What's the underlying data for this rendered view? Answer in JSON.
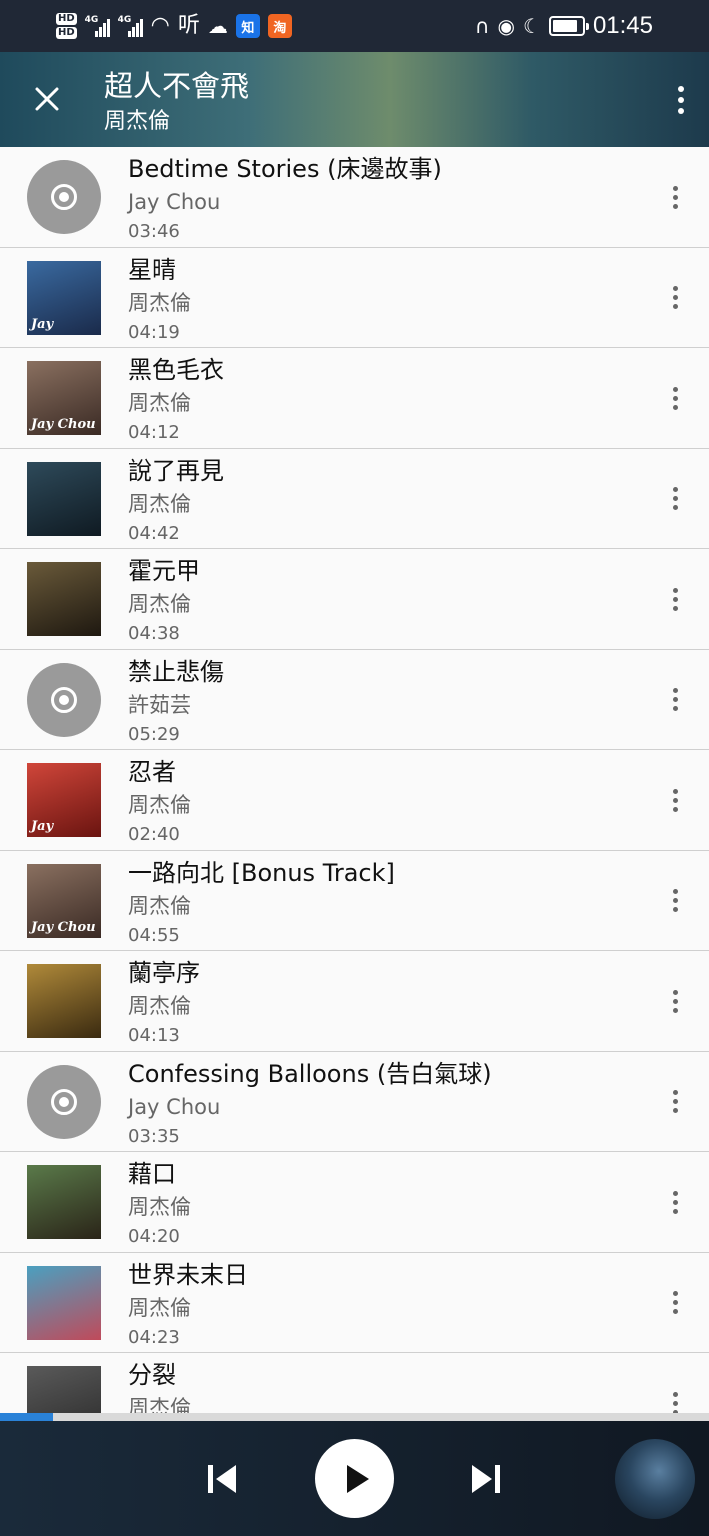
{
  "status_bar": {
    "hd_labels": [
      "HD",
      "HD"
    ],
    "network_1": "4G",
    "network_2": "4G",
    "app_text": "听",
    "badge_zhi": "知",
    "badge_tao": "淘",
    "battery_level": 0.85,
    "time": "01:45"
  },
  "header": {
    "title": "超人不會飛",
    "subtitle": "周杰倫"
  },
  "songs": [
    {
      "title": "Bedtime Stories (床邊故事)",
      "artist": "Jay Chou",
      "duration": "03:46",
      "art": "disc"
    },
    {
      "title": "星晴",
      "artist": "周杰倫",
      "duration": "04:19",
      "art": "cover",
      "art_text": "Jay",
      "colors": [
        "#3a6aa0",
        "#1a2a4a"
      ]
    },
    {
      "title": "黑色毛衣",
      "artist": "周杰倫",
      "duration": "04:12",
      "art": "cover",
      "art_text": "Jay Chou",
      "colors": [
        "#8a7060",
        "#3a2a24"
      ]
    },
    {
      "title": "說了再見",
      "artist": "周杰倫",
      "duration": "04:42",
      "art": "cover",
      "art_text": "",
      "colors": [
        "#2e4a5a",
        "#0f1a22"
      ]
    },
    {
      "title": "霍元甲",
      "artist": "周杰倫",
      "duration": "04:38",
      "art": "cover",
      "art_text": "",
      "colors": [
        "#6a5a3a",
        "#1e1810"
      ]
    },
    {
      "title": "禁止悲傷",
      "artist": "許茹芸",
      "duration": "05:29",
      "art": "disc"
    },
    {
      "title": "忍者",
      "artist": "周杰倫",
      "duration": "02:40",
      "art": "cover",
      "art_text": "Jay",
      "colors": [
        "#d0463a",
        "#6a1410"
      ]
    },
    {
      "title": "一路向北 [Bonus Track]",
      "artist": "周杰倫",
      "duration": "04:55",
      "art": "cover",
      "art_text": "Jay Chou",
      "colors": [
        "#8a7060",
        "#3a2a24"
      ]
    },
    {
      "title": "蘭亭序",
      "artist": "周杰倫",
      "duration": "04:13",
      "art": "cover",
      "art_text": "",
      "colors": [
        "#b08a3a",
        "#3a2a10"
      ]
    },
    {
      "title": "Confessing Balloons (告白氣球)",
      "artist": "Jay Chou",
      "duration": "03:35",
      "art": "disc"
    },
    {
      "title": "藉口",
      "artist": "周杰倫",
      "duration": "04:20",
      "art": "cover",
      "art_text": "",
      "colors": [
        "#5a7a4a",
        "#2a2418"
      ]
    },
    {
      "title": "世界未末日",
      "artist": "周杰倫",
      "duration": "04:23",
      "art": "cover",
      "art_text": "",
      "colors": [
        "#4aa0c0",
        "#c04a5a"
      ]
    },
    {
      "title": "分裂",
      "artist": "周杰倫",
      "duration": "",
      "art": "cover",
      "art_text": "",
      "colors": [
        "#5a5a5a",
        "#2a2a2a"
      ]
    }
  ],
  "player": {
    "progress": 0.075,
    "prev_icon": "skip-previous-icon",
    "play_icon": "play-icon",
    "next_icon": "skip-next-icon"
  },
  "colors": {
    "header_gradient": [
      "#1f4a5c",
      "#6e8c6c"
    ],
    "progress_fill": "#2a82d8",
    "player_bg": "#101822"
  }
}
